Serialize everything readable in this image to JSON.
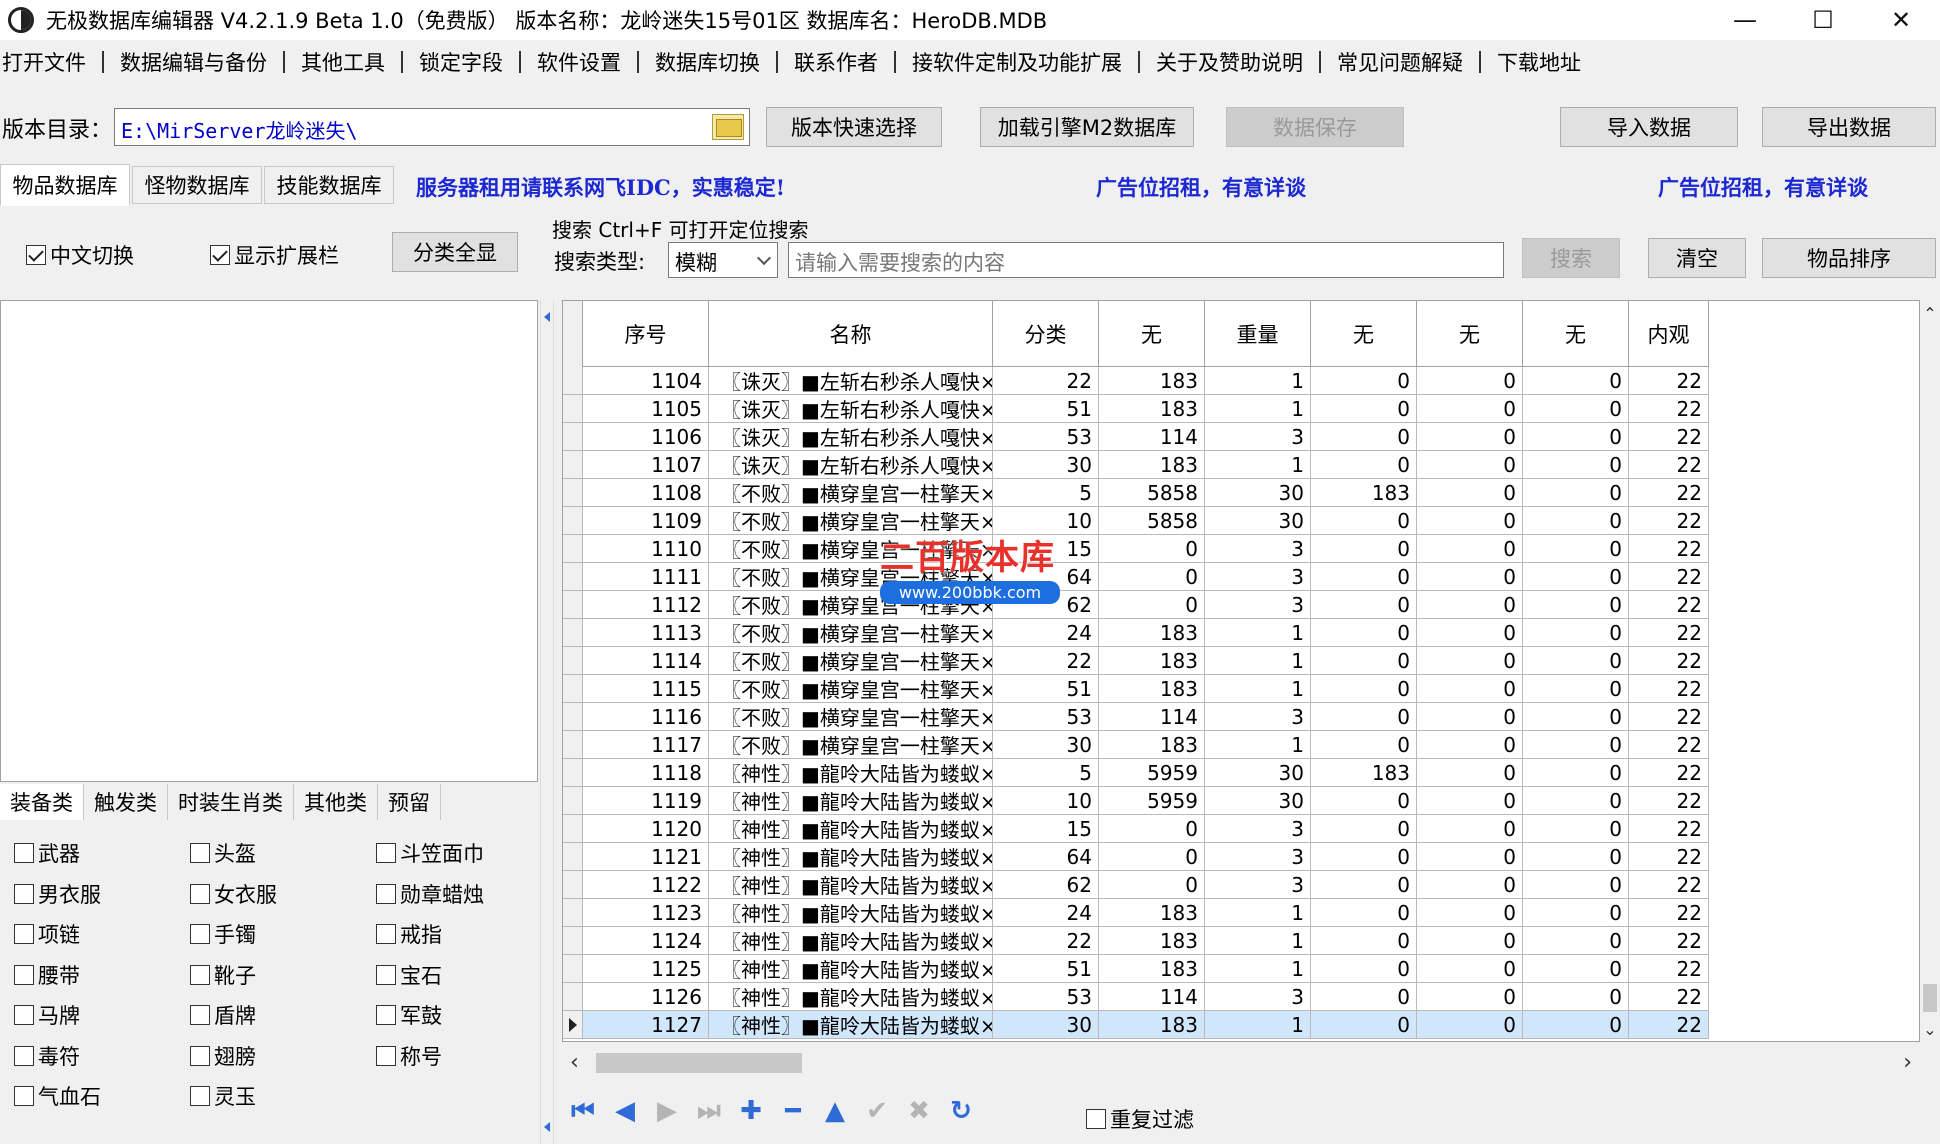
{
  "window": {
    "title": "无极数据库编辑器 V4.2.1.9    Beta 1.0（免费版）    版本名称：龙岭迷失15号01区    数据库名：HeroDB.MDB",
    "minimize": "—",
    "maximize": "☐",
    "close": "✕"
  },
  "menu": [
    "打开文件",
    "数据编辑与备份",
    "其他工具",
    "锁定字段",
    "软件设置",
    "数据库切换",
    "联系作者",
    "接软件定制及功能扩展",
    "关于及赞助说明",
    "常见问题解疑",
    "下载地址"
  ],
  "toolbar": {
    "dir_label": "版本目录：",
    "dir_value": "E:\\MirServer龙岭迷失\\",
    "quick_select": "版本快速选择",
    "load_m2": "加载引擎M2数据库",
    "save": "数据保存",
    "import": "导入数据",
    "export": "导出数据"
  },
  "db_tabs": [
    "物品数据库",
    "怪物数据库",
    "技能数据库"
  ],
  "promos": [
    "服务器租用请联系网飞IDC，实惠稳定!",
    "广告位招租，有意详谈",
    "广告位招租，有意详谈"
  ],
  "options": {
    "chinese_switch": "中文切换",
    "show_ext": "显示扩展栏",
    "show_all": "分类全显"
  },
  "search": {
    "title": "搜索   Ctrl+F 可打开定位搜索",
    "type_label": "搜索类型:",
    "type_value": "模糊",
    "placeholder": "请输入需要搜索的内容",
    "search_btn": "搜索",
    "clear_btn": "清空",
    "sort_btn": "物品排序"
  },
  "category_tabs": [
    "装备类",
    "触发类",
    "时装生肖类",
    "其他类",
    "预留"
  ],
  "categories": [
    "武器",
    "头盔",
    "斗笠面巾",
    "男衣服",
    "女衣服",
    "勋章蜡烛",
    "项链",
    "手镯",
    "戒指",
    "腰带",
    "靴子",
    "宝石",
    "马牌",
    "盾牌",
    "军鼓",
    "毒符",
    "翅膀",
    "称号",
    "气血石",
    "灵玉"
  ],
  "grid": {
    "columns": [
      "序号",
      "名称",
      "分类",
      "无",
      "重量",
      "无",
      "无",
      "无",
      "内观"
    ],
    "rows": [
      [
        "1104",
        "〖诛灭〗■左斩右秒杀人嘎快×戒",
        "22",
        "183",
        "1",
        "0",
        "0",
        "0",
        "22"
      ],
      [
        "1105",
        "〖诛灭〗■左斩右秒杀人嘎快×符",
        "51",
        "183",
        "1",
        "0",
        "0",
        "0",
        "22"
      ],
      [
        "1106",
        "〖诛灭〗■左斩右秒杀人嘎快×石",
        "53",
        "114",
        "3",
        "0",
        "0",
        "0",
        "22"
      ],
      [
        "1107",
        "〖诛灭〗■左斩右秒杀人嘎快×章",
        "30",
        "183",
        "1",
        "0",
        "0",
        "0",
        "22"
      ],
      [
        "1108",
        "〖不败〗■横穿皇宫一柱擎天×剑",
        "5",
        "5858",
        "30",
        "183",
        "0",
        "0",
        "22"
      ],
      [
        "1109",
        "〖不败〗■横穿皇宫一柱擎天×甲",
        "10",
        "5858",
        "30",
        "0",
        "0",
        "0",
        "22"
      ],
      [
        "1110",
        "〖不败〗■横穿皇宫一柱擎天×帽",
        "15",
        "0",
        "3",
        "0",
        "0",
        "0",
        "22"
      ],
      [
        "1111",
        "〖不败〗■横穿皇宫一柱擎天×带",
        "64",
        "0",
        "3",
        "0",
        "0",
        "0",
        "22"
      ],
      [
        "1112",
        "〖不败〗■横穿皇宫一柱擎天×鞋",
        "62",
        "0",
        "3",
        "0",
        "0",
        "0",
        "22"
      ],
      [
        "1113",
        "〖不败〗■横穿皇宫一柱擎天×镯",
        "24",
        "183",
        "1",
        "0",
        "0",
        "0",
        "22"
      ],
      [
        "1114",
        "〖不败〗■横穿皇宫一柱擎天×戒",
        "22",
        "183",
        "1",
        "0",
        "0",
        "0",
        "22"
      ],
      [
        "1115",
        "〖不败〗■横穿皇宫一柱擎天×符",
        "51",
        "183",
        "1",
        "0",
        "0",
        "0",
        "22"
      ],
      [
        "1116",
        "〖不败〗■横穿皇宫一柱擎天×石",
        "53",
        "114",
        "3",
        "0",
        "0",
        "0",
        "22"
      ],
      [
        "1117",
        "〖不败〗■横穿皇宫一柱擎天×章",
        "30",
        "183",
        "1",
        "0",
        "0",
        "0",
        "22"
      ],
      [
        "1118",
        "〖神性〗■龍呤大陆皆为蝼蚁×剑",
        "5",
        "5959",
        "30",
        "183",
        "0",
        "0",
        "22"
      ],
      [
        "1119",
        "〖神性〗■龍呤大陆皆为蝼蚁×甲",
        "10",
        "5959",
        "30",
        "0",
        "0",
        "0",
        "22"
      ],
      [
        "1120",
        "〖神性〗■龍呤大陆皆为蝼蚁×帽",
        "15",
        "0",
        "3",
        "0",
        "0",
        "0",
        "22"
      ],
      [
        "1121",
        "〖神性〗■龍呤大陆皆为蝼蚁×带",
        "64",
        "0",
        "3",
        "0",
        "0",
        "0",
        "22"
      ],
      [
        "1122",
        "〖神性〗■龍呤大陆皆为蝼蚁×鞋",
        "62",
        "0",
        "3",
        "0",
        "0",
        "0",
        "22"
      ],
      [
        "1123",
        "〖神性〗■龍呤大陆皆为蝼蚁×镯",
        "24",
        "183",
        "1",
        "0",
        "0",
        "0",
        "22"
      ],
      [
        "1124",
        "〖神性〗■龍呤大陆皆为蝼蚁×戒",
        "22",
        "183",
        "1",
        "0",
        "0",
        "0",
        "22"
      ],
      [
        "1125",
        "〖神性〗■龍呤大陆皆为蝼蚁×符",
        "51",
        "183",
        "1",
        "0",
        "0",
        "0",
        "22"
      ],
      [
        "1126",
        "〖神性〗■龍呤大陆皆为蝼蚁×石",
        "53",
        "114",
        "3",
        "0",
        "0",
        "0",
        "22"
      ],
      [
        "1127",
        "〖神性〗■龍呤大陆皆为蝼蚁×章",
        "30",
        "183",
        "1",
        "0",
        "0",
        "0",
        "22"
      ]
    ]
  },
  "navigator": {
    "icons": [
      "first-icon",
      "prior-icon",
      "next-icon",
      "last-icon",
      "insert-icon",
      "delete-icon",
      "edit-icon",
      "post-icon",
      "cancel-icon",
      "refresh-icon"
    ],
    "glyphs": [
      "⏮",
      "◀",
      "▶",
      "⏭",
      "✚",
      "━",
      "▲",
      "✔",
      "✖",
      "↻"
    ],
    "dup_filter": "重复过滤"
  },
  "watermark": {
    "title": "二百版本库",
    "url": "www.200bbk.com"
  },
  "colors": {
    "promo": "#1c28d2",
    "nav_blue": "#2f6bd6",
    "selected_row": "#cfe6fb",
    "watermark_red": "#e8312b"
  }
}
